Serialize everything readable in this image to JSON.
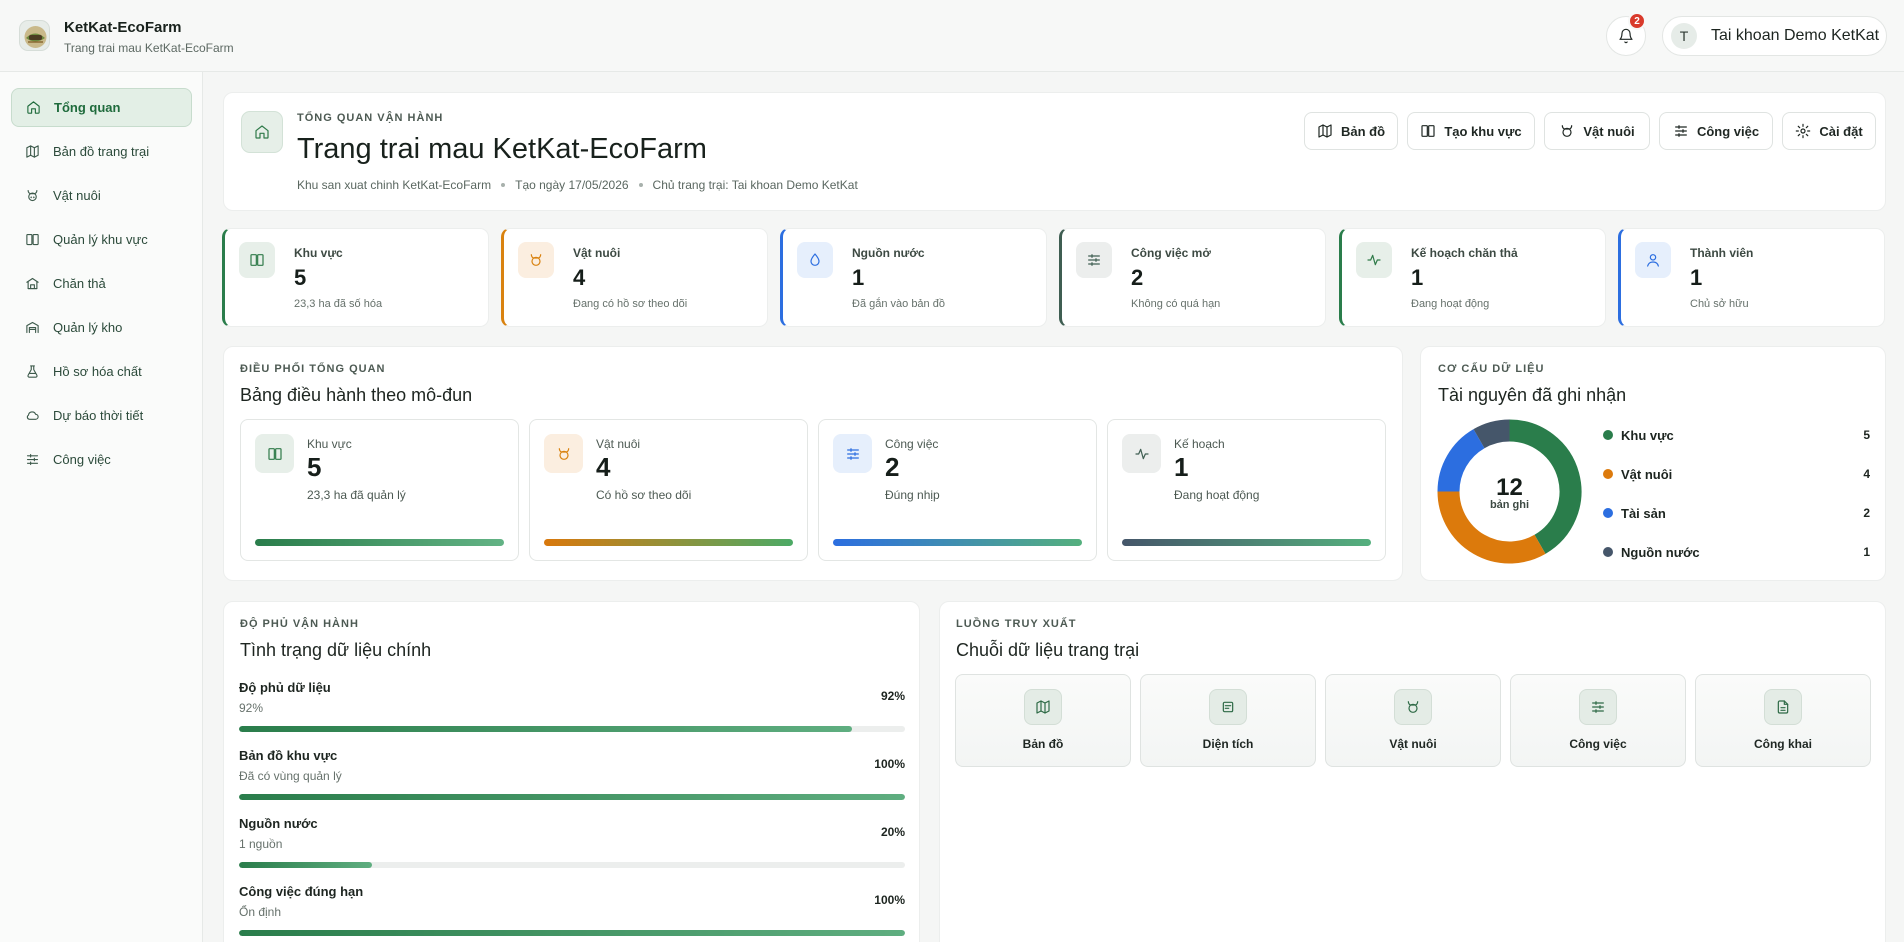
{
  "topbar": {
    "brand_name": "KetKat-EcoFarm",
    "brand_sub": "Trang trai mau KetKat-EcoFarm",
    "notifications": "2",
    "user_initial": "T",
    "user_name": "Tai khoan Demo KetKat"
  },
  "sidebar": {
    "items": [
      {
        "label": "Tổng quan",
        "icon": "home-icon"
      },
      {
        "label": "Bản đồ trang trại",
        "icon": "map-icon"
      },
      {
        "label": "Vật nuôi",
        "icon": "cattle-icon"
      },
      {
        "label": "Quản lý khu vực",
        "icon": "area-icon"
      },
      {
        "label": "Chăn thả",
        "icon": "barn-icon"
      },
      {
        "label": "Quản lý kho",
        "icon": "warehouse-icon"
      },
      {
        "label": "Hồ sơ hóa chất",
        "icon": "flask-icon"
      },
      {
        "label": "Dự báo thời tiết",
        "icon": "cloud-icon"
      },
      {
        "label": "Công việc",
        "icon": "tasks-icon"
      }
    ]
  },
  "header": {
    "eyebrow": "TỔNG QUAN VẬN HÀNH",
    "title": "Trang trai mau KetKat-EcoFarm",
    "meta": [
      "Khu san xuat chinh KetKat-EcoFarm",
      "Tạo ngày 17/05/2026",
      "Chủ trang trại: Tai khoan Demo KetKat"
    ],
    "buttons": [
      "Bản đồ",
      "Tạo khu vực",
      "Vật nuôi",
      "Công việc",
      "Cài đặt"
    ]
  },
  "stats": [
    {
      "label": "Khu vực",
      "value": "5",
      "sub": "23,3 ha đã số hóa",
      "color": "#2a7d4b"
    },
    {
      "label": "Vật nuôi",
      "value": "4",
      "sub": "Đang có hồ sơ theo dõi",
      "color": "#d9820f"
    },
    {
      "label": "Nguồn nước",
      "value": "1",
      "sub": "Đã gắn vào bản đồ",
      "color": "#2c6ee0"
    },
    {
      "label": "Công việc mở",
      "value": "2",
      "sub": "Không có quá hạn",
      "color": "#3f5e52"
    },
    {
      "label": "Kế hoạch chăn thả",
      "value": "1",
      "sub": "Đang hoạt động",
      "color": "#2a7d4b"
    },
    {
      "label": "Thành viên",
      "value": "1",
      "sub": "Chủ sở hữu",
      "color": "#2c6ee0"
    }
  ],
  "modules": {
    "eyebrow": "ĐIỀU PHỐI TỔNG QUAN",
    "title": "Bảng điều hành theo mô-đun",
    "items": [
      {
        "label": "Khu vực",
        "value": "5",
        "sub": "23,3 ha đã quản lý"
      },
      {
        "label": "Vật nuôi",
        "value": "4",
        "sub": "Có hồ sơ theo dõi"
      },
      {
        "label": "Công việc",
        "value": "2",
        "sub": "Đúng nhịp"
      },
      {
        "label": "Kế hoạch",
        "value": "1",
        "sub": "Đang hoạt động"
      }
    ]
  },
  "structure": {
    "eyebrow": "CƠ CẤU DỮ LIỆU",
    "title": "Tài nguyên đã ghi nhận",
    "total": "12",
    "total_label": "bản ghi",
    "legend": [
      {
        "name": "Khu vực",
        "value": 5,
        "color": "#2a7d4b"
      },
      {
        "name": "Vật nuôi",
        "value": 4,
        "color": "#dc7a0c"
      },
      {
        "name": "Tài sản",
        "value": 2,
        "color": "#2c6ee0"
      },
      {
        "name": "Nguồn nước",
        "value": 1,
        "color": "#45566a"
      }
    ]
  },
  "coverage": {
    "eyebrow": "ĐỘ PHỦ VẬN HÀNH",
    "title": "Tình trạng dữ liệu chính",
    "items": [
      {
        "name": "Độ phủ dữ liệu",
        "sub": "92%",
        "pct_text": "92%",
        "pct": 92
      },
      {
        "name": "Bản đồ khu vực",
        "sub": "Đã có vùng quản lý",
        "pct_text": "100%",
        "pct": 100
      },
      {
        "name": "Nguồn nước",
        "sub": "1 nguồn",
        "pct_text": "20%",
        "pct": 20
      },
      {
        "name": "Công việc đúng hạn",
        "sub": "Ổn định",
        "pct_text": "100%",
        "pct": 100
      }
    ]
  },
  "flow": {
    "eyebrow": "LUỒNG TRUY XUẤT",
    "title": "Chuỗi dữ liệu trang trại",
    "items": [
      {
        "label": "Bản đồ",
        "icon": "map-icon"
      },
      {
        "label": "Diện tích",
        "icon": "area-doc-icon"
      },
      {
        "label": "Vật nuôi",
        "icon": "cattle-icon"
      },
      {
        "label": "Công việc",
        "icon": "tasks-icon"
      },
      {
        "label": "Công khai",
        "icon": "document-icon"
      }
    ]
  }
}
